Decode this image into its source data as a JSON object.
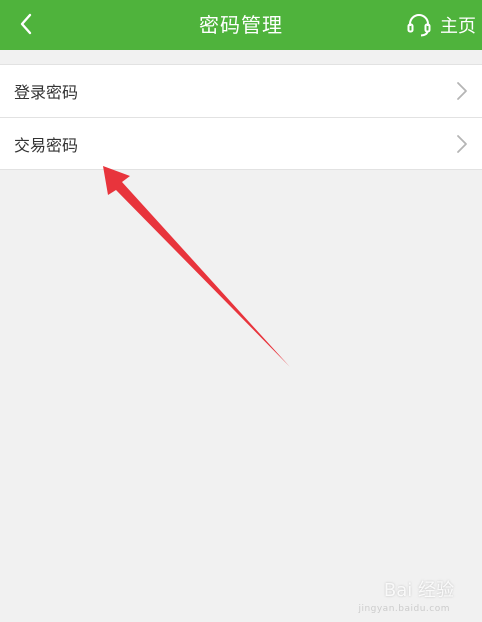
{
  "header": {
    "title": "密码管理",
    "home_label": "主页",
    "background_color": "#4fb33c",
    "back_icon": "chevron-left-icon",
    "home_icon": "headset-icon"
  },
  "list": {
    "items": [
      {
        "label": "登录密码",
        "icon": "chevron-right-icon"
      },
      {
        "label": "交易密码",
        "icon": "chevron-right-icon"
      }
    ]
  },
  "annotation": {
    "arrow_color": "#e8343c",
    "points_to": "交易密码"
  },
  "watermark": {
    "brand": "Bai 经验",
    "url": "jingyan.baidu.com"
  }
}
